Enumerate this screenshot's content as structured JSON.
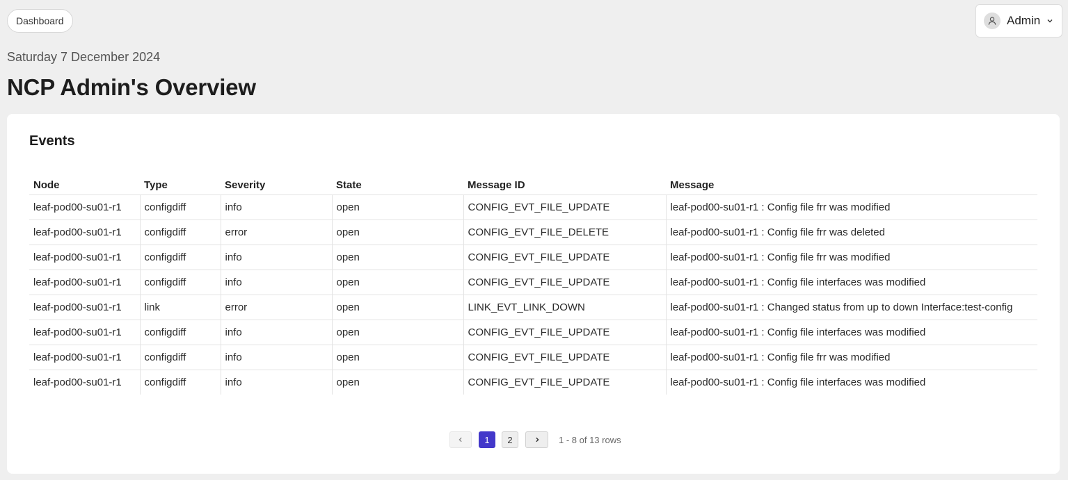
{
  "header": {
    "breadcrumb": "Dashboard",
    "user_name": "Admin",
    "date": "Saturday 7 December 2024",
    "title": "NCP Admin's Overview"
  },
  "events": {
    "title": "Events",
    "columns": [
      "Node",
      "Type",
      "Severity",
      "State",
      "Message ID",
      "Message"
    ],
    "rows": [
      [
        "leaf-pod00-su01-r1",
        "configdiff",
        "info",
        "open",
        "CONFIG_EVT_FILE_UPDATE",
        "leaf-pod00-su01-r1 : Config file frr was modified"
      ],
      [
        "leaf-pod00-su01-r1",
        "configdiff",
        "error",
        "open",
        "CONFIG_EVT_FILE_DELETE",
        "leaf-pod00-su01-r1 : Config file frr was deleted"
      ],
      [
        "leaf-pod00-su01-r1",
        "configdiff",
        "info",
        "open",
        "CONFIG_EVT_FILE_UPDATE",
        "leaf-pod00-su01-r1 : Config file frr was modified"
      ],
      [
        "leaf-pod00-su01-r1",
        "configdiff",
        "info",
        "open",
        "CONFIG_EVT_FILE_UPDATE",
        "leaf-pod00-su01-r1 : Config file interfaces was modified"
      ],
      [
        "leaf-pod00-su01-r1",
        "link",
        "error",
        "open",
        "LINK_EVT_LINK_DOWN",
        "leaf-pod00-su01-r1 : Changed status from up to down Interface:test-config"
      ],
      [
        "leaf-pod00-su01-r1",
        "configdiff",
        "info",
        "open",
        "CONFIG_EVT_FILE_UPDATE",
        "leaf-pod00-su01-r1 : Config file interfaces was modified"
      ],
      [
        "leaf-pod00-su01-r1",
        "configdiff",
        "info",
        "open",
        "CONFIG_EVT_FILE_UPDATE",
        "leaf-pod00-su01-r1 : Config file frr was modified"
      ],
      [
        "leaf-pod00-su01-r1",
        "configdiff",
        "info",
        "open",
        "CONFIG_EVT_FILE_UPDATE",
        "leaf-pod00-su01-r1 : Config file interfaces was modified"
      ]
    ]
  },
  "pagination": {
    "prev_icon": "chevron-left-icon",
    "next_icon": "chevron-right-icon",
    "pages": [
      "1",
      "2"
    ],
    "current_page": "1",
    "info": "1 - 8 of 13 rows"
  },
  "colors": {
    "accent": "#4338ca",
    "background": "#efefef",
    "card": "#ffffff"
  },
  "icons": {
    "avatar": "user-icon",
    "menu": "chevron-down-icon"
  }
}
